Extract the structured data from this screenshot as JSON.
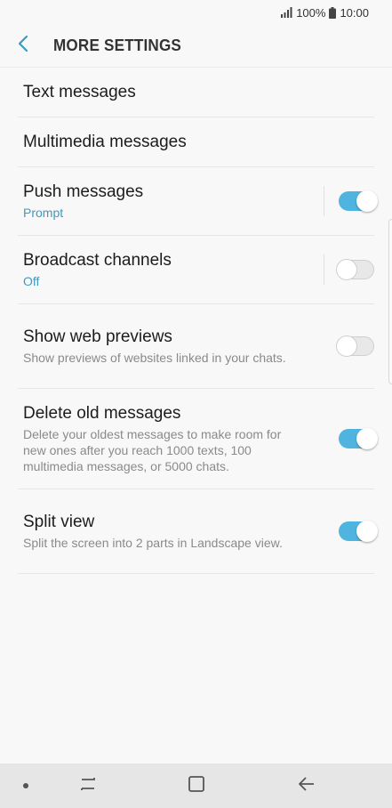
{
  "status": {
    "battery": "100%",
    "time": "10:00"
  },
  "header": {
    "title": "MORE SETTINGS"
  },
  "settings": [
    {
      "label": "Text messages"
    },
    {
      "label": "Multimedia messages"
    },
    {
      "label": "Push messages",
      "sub": "Prompt",
      "toggle": true
    },
    {
      "label": "Broadcast channels",
      "sub": "Off",
      "toggle": false
    },
    {
      "label": "Show web previews",
      "sub": "Show previews of websites linked in your chats.",
      "toggle": false
    },
    {
      "label": "Delete old messages",
      "sub": "Delete your oldest messages to make room for new ones after you reach 1000 texts, 100 multimedia messages, or 5000 chats.",
      "toggle": true
    },
    {
      "label": "Split view",
      "sub": "Split the screen into 2 parts in Landscape view.",
      "toggle": true
    }
  ],
  "colors": {
    "accent": "#3a9bc0",
    "toggle_on": "#4fb4e0"
  },
  "icons": {
    "back": "chevron-left-icon",
    "recent": "recent-apps-icon",
    "home": "home-icon",
    "nav_back": "back-arrow-icon"
  }
}
